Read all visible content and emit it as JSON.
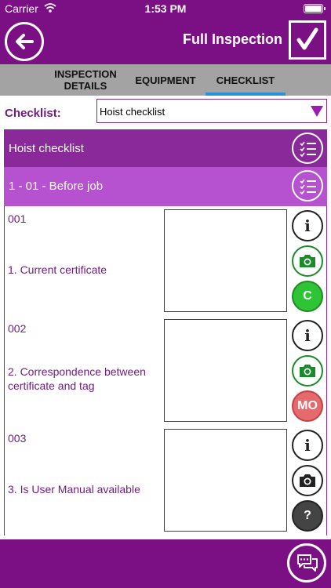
{
  "status_bar": {
    "carrier": "Carrier",
    "time": "1:53 PM"
  },
  "header": {
    "title": "Full Inspection"
  },
  "tabs": [
    {
      "label": "INSPECTION DETAILS",
      "active": false
    },
    {
      "label": "EQUIPMENT",
      "active": false
    },
    {
      "label": "CHECKLIST",
      "active": true
    }
  ],
  "checklist_select": {
    "label": "Checklist:",
    "value": "Hoist checklist"
  },
  "sections": {
    "checklist_title": "Hoist checklist",
    "group_title": "1 - 01 - Before job"
  },
  "items": [
    {
      "code": "001",
      "description": "1. Current certificate",
      "status": "C",
      "status_color": "#2fc436",
      "camera_color": "#1a8a2a"
    },
    {
      "code": "002",
      "description": "2. Correspondence between certificate and tag",
      "status": "MO",
      "status_color": "#e46a6e",
      "camera_color": "#1a8a2a"
    },
    {
      "code": "003",
      "description": "3. Is User Manual available",
      "status": "?",
      "status_color": "#444444",
      "camera_color": "#222222"
    }
  ],
  "icons": {
    "back": "arrow-left-icon",
    "complete": "checkmark-icon",
    "list": "checklist-icon",
    "info": "info-icon",
    "camera": "camera-icon",
    "chat": "chat-icon"
  },
  "colors": {
    "brand": "#7b0f84",
    "section_dark": "#8a2a9a",
    "section_light": "#b651cf",
    "tab_bar": "#a3a3a3",
    "tab_active": "#2a90d8"
  }
}
